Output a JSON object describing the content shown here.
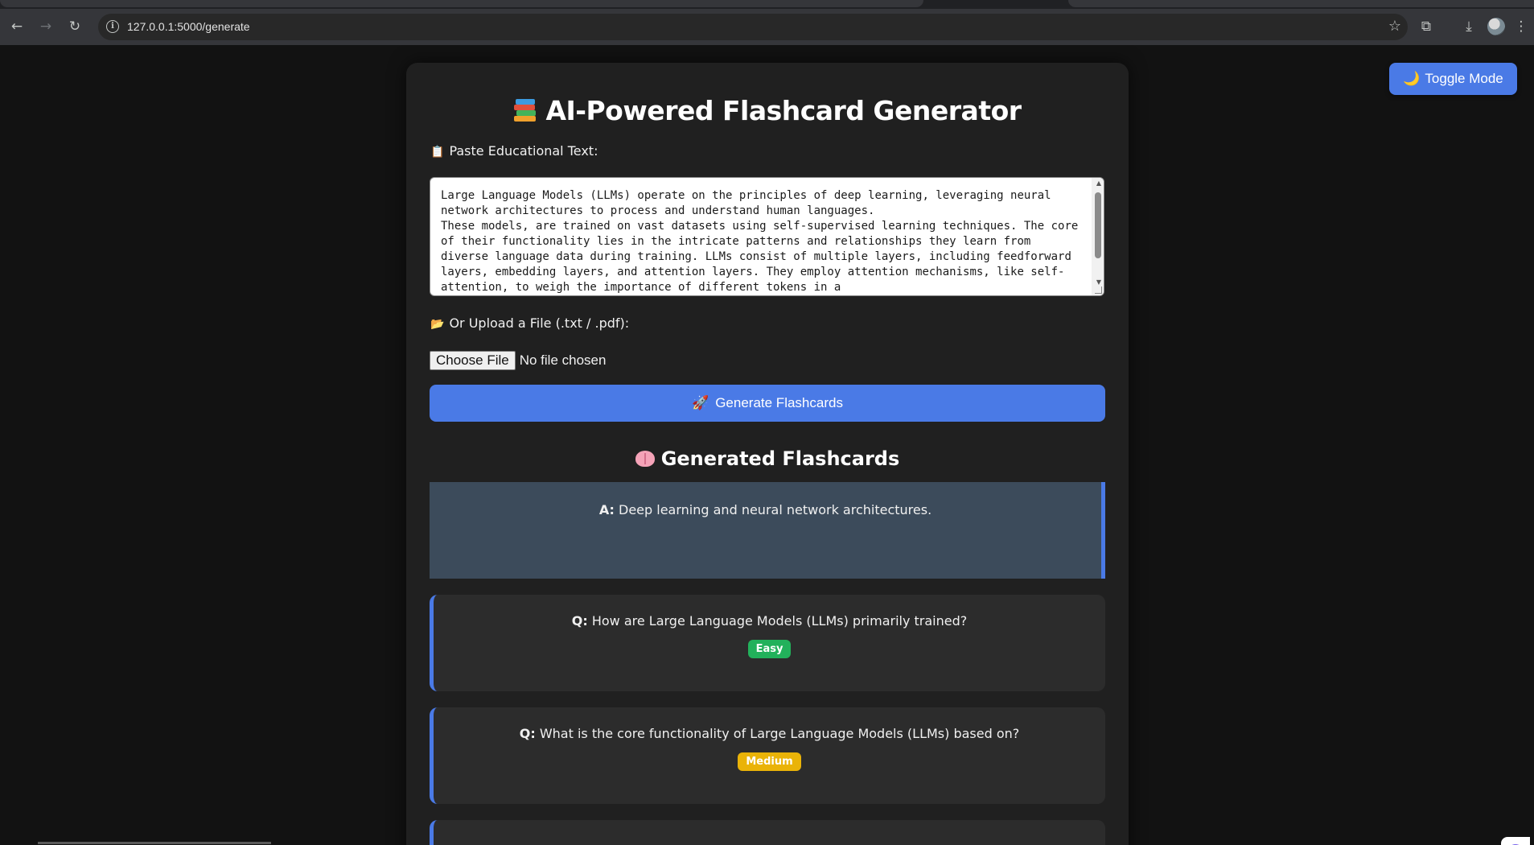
{
  "browser": {
    "url": "127.0.0.1:5000/generate",
    "back_icon": "←",
    "forward_icon": "→",
    "reload_icon": "↻",
    "star_icon": "☆",
    "extensions_icon": "⧉",
    "download_icon": "⤓",
    "menu_icon": "⋮"
  },
  "toggle": {
    "label": "Toggle Mode",
    "icon": "🌙"
  },
  "header": {
    "title": "AI-Powered Flashcard Generator"
  },
  "input": {
    "paste_label": "Paste Educational Text:",
    "paste_icon": "📋",
    "text": "Large Language Models (LLMs) operate on the principles of deep learning, leveraging neural network architectures to process and understand human languages.\nThese models, are trained on vast datasets using self-supervised learning techniques. The core of their functionality lies in the intricate patterns and relationships they learn from diverse language data during training. LLMs consist of multiple layers, including feedforward layers, embedding layers, and attention layers. They employ attention mechanisms, like self-attention, to weigh the importance of different tokens in a",
    "upload_label": "Or Upload a File (.txt / .pdf):",
    "upload_icon": "📂",
    "choose_file": "Choose File",
    "no_file": "No file chosen",
    "generate_label": "Generate Flashcards",
    "generate_icon": "🚀"
  },
  "results": {
    "heading": "Generated Flashcards",
    "cards": [
      {
        "prefix": "A:",
        "text": "Deep learning and neural network architectures."
      },
      {
        "prefix": "Q:",
        "text": "How are Large Language Models (LLMs) primarily trained?",
        "difficulty": "Easy",
        "color": "#22b15b"
      },
      {
        "prefix": "Q:",
        "text": "What is the core functionality of Large Language Models (LLMs) based on?",
        "difficulty": "Medium",
        "color": "#eab308"
      }
    ]
  },
  "colors": {
    "accent": "#4a7ae6",
    "card_bg": "#202020",
    "answer_bg": "#3c4b5b"
  }
}
